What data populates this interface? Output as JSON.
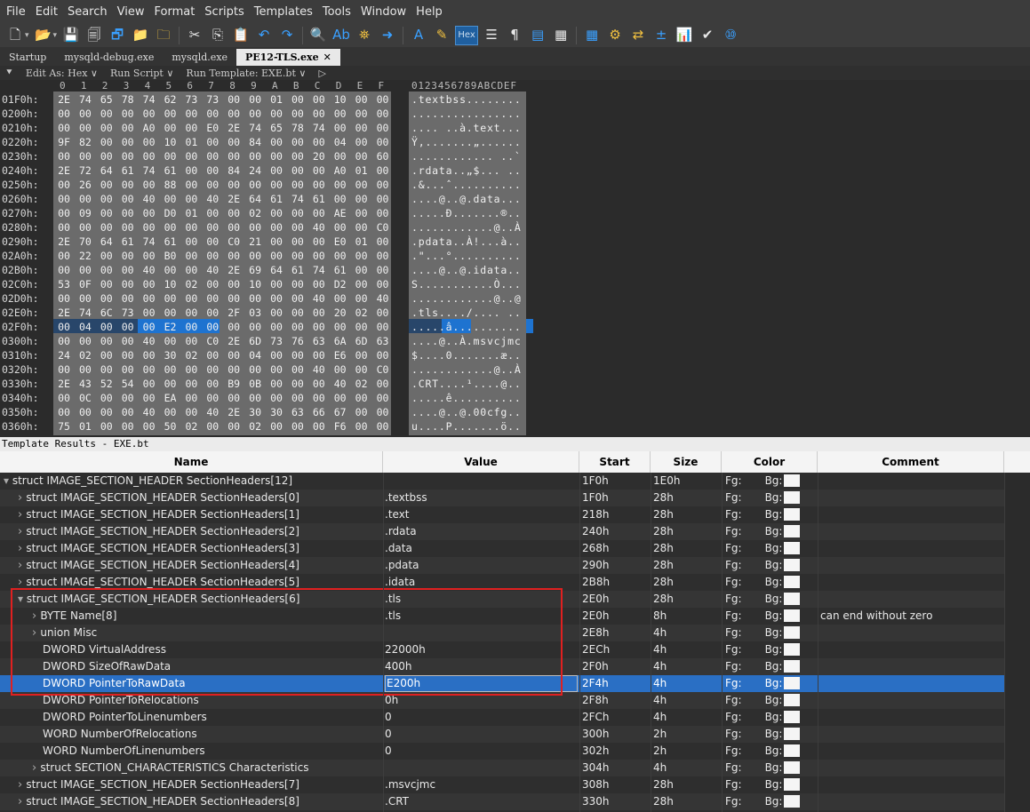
{
  "menu": [
    "File",
    "Edit",
    "Search",
    "View",
    "Format",
    "Scripts",
    "Templates",
    "Tools",
    "Window",
    "Help"
  ],
  "toolbar": {
    "icons": [
      "new-file-icon",
      "open-folder-icon",
      "save-icon",
      "save-as-icon",
      "save-all-icon",
      "open-folder-2-icon",
      "open-folders-icon",
      "cut-icon",
      "copy-icon",
      "paste-icon",
      "undo-icon",
      "redo-icon",
      "find-icon",
      "replace-icon",
      "find-in-files-icon",
      "goto-icon",
      "font-icon",
      "highlight-icon",
      "hex-mode-icon",
      "columns-icon",
      "pilcrow-icon",
      "text-mode-icon",
      "binary-mode-icon",
      "calculator-icon",
      "template-icon",
      "compare-icon",
      "operations-icon",
      "histogram-icon",
      "checksum-icon",
      "base-converter-icon"
    ],
    "hex_label": "Hex"
  },
  "tabs": [
    {
      "label": "Startup",
      "active": false
    },
    {
      "label": "mysqld-debug.exe",
      "active": false
    },
    {
      "label": "mysqld.exe",
      "active": false
    },
    {
      "label": "PE12-TLS.exe",
      "active": true,
      "close": "✕"
    }
  ],
  "subbar": {
    "edit_as": "Edit As: Hex ∨",
    "run_script": "Run Script ∨",
    "run_template": "Run Template: EXE.bt ∨",
    "play": "▷"
  },
  "hex": {
    "col_headers": [
      "0",
      "1",
      "2",
      "3",
      "4",
      "5",
      "6",
      "7",
      "8",
      "9",
      "A",
      "B",
      "C",
      "D",
      "E",
      "F"
    ],
    "ascii_header": "0123456789ABCDEF",
    "rows": [
      {
        "addr": "01F0h:",
        "bytes": [
          "2E",
          "74",
          "65",
          "78",
          "74",
          "62",
          "73",
          "73",
          "00",
          "00",
          "01",
          "00",
          "00",
          "10",
          "00",
          "00"
        ],
        "ascii": ".textbss........"
      },
      {
        "addr": "0200h:",
        "bytes": [
          "00",
          "00",
          "00",
          "00",
          "00",
          "00",
          "00",
          "00",
          "00",
          "00",
          "00",
          "00",
          "00",
          "00",
          "00",
          "00"
        ],
        "ascii": "................"
      },
      {
        "addr": "0210h:",
        "bytes": [
          "00",
          "00",
          "00",
          "00",
          "A0",
          "00",
          "00",
          "E0",
          "2E",
          "74",
          "65",
          "78",
          "74",
          "00",
          "00",
          "00"
        ],
        "ascii": ".... ..à.text..."
      },
      {
        "addr": "0220h:",
        "bytes": [
          "9F",
          "82",
          "00",
          "00",
          "00",
          "10",
          "01",
          "00",
          "00",
          "84",
          "00",
          "00",
          "00",
          "04",
          "00",
          "00"
        ],
        "ascii": "Ÿ‚.......„......"
      },
      {
        "addr": "0230h:",
        "bytes": [
          "00",
          "00",
          "00",
          "00",
          "00",
          "00",
          "00",
          "00",
          "00",
          "00",
          "00",
          "00",
          "20",
          "00",
          "00",
          "60"
        ],
        "ascii": "............ ..`"
      },
      {
        "addr": "0240h:",
        "bytes": [
          "2E",
          "72",
          "64",
          "61",
          "74",
          "61",
          "00",
          "00",
          "84",
          "24",
          "00",
          "00",
          "00",
          "A0",
          "01",
          "00"
        ],
        "ascii": ".rdata..„$... .."
      },
      {
        "addr": "0250h:",
        "bytes": [
          "00",
          "26",
          "00",
          "00",
          "00",
          "88",
          "00",
          "00",
          "00",
          "00",
          "00",
          "00",
          "00",
          "00",
          "00",
          "00"
        ],
        "ascii": ".&...ˆ.........."
      },
      {
        "addr": "0260h:",
        "bytes": [
          "00",
          "00",
          "00",
          "00",
          "40",
          "00",
          "00",
          "40",
          "2E",
          "64",
          "61",
          "74",
          "61",
          "00",
          "00",
          "00"
        ],
        "ascii": "....@..@.data..."
      },
      {
        "addr": "0270h:",
        "bytes": [
          "00",
          "09",
          "00",
          "00",
          "00",
          "D0",
          "01",
          "00",
          "00",
          "02",
          "00",
          "00",
          "00",
          "AE",
          "00",
          "00"
        ],
        "ascii": ".....Ð.......®.."
      },
      {
        "addr": "0280h:",
        "bytes": [
          "00",
          "00",
          "00",
          "00",
          "00",
          "00",
          "00",
          "00",
          "00",
          "00",
          "00",
          "00",
          "40",
          "00",
          "00",
          "C0"
        ],
        "ascii": "............@..À"
      },
      {
        "addr": "0290h:",
        "bytes": [
          "2E",
          "70",
          "64",
          "61",
          "74",
          "61",
          "00",
          "00",
          "C0",
          "21",
          "00",
          "00",
          "00",
          "E0",
          "01",
          "00"
        ],
        "ascii": ".pdata..À!...à.."
      },
      {
        "addr": "02A0h:",
        "bytes": [
          "00",
          "22",
          "00",
          "00",
          "00",
          "B0",
          "00",
          "00",
          "00",
          "00",
          "00",
          "00",
          "00",
          "00",
          "00",
          "00"
        ],
        "ascii": ".\"...°.........."
      },
      {
        "addr": "02B0h:",
        "bytes": [
          "00",
          "00",
          "00",
          "00",
          "40",
          "00",
          "00",
          "40",
          "2E",
          "69",
          "64",
          "61",
          "74",
          "61",
          "00",
          "00"
        ],
        "ascii": "....@..@.idata.."
      },
      {
        "addr": "02C0h:",
        "bytes": [
          "53",
          "0F",
          "00",
          "00",
          "00",
          "10",
          "02",
          "00",
          "00",
          "10",
          "00",
          "00",
          "00",
          "D2",
          "00",
          "00"
        ],
        "ascii": "S...........Ò..."
      },
      {
        "addr": "02D0h:",
        "bytes": [
          "00",
          "00",
          "00",
          "00",
          "00",
          "00",
          "00",
          "00",
          "00",
          "00",
          "00",
          "00",
          "40",
          "00",
          "00",
          "40"
        ],
        "ascii": "............@..@"
      },
      {
        "addr": "02E0h:",
        "bytes": [
          "2E",
          "74",
          "6C",
          "73",
          "00",
          "00",
          "00",
          "00",
          "2F",
          "03",
          "00",
          "00",
          "00",
          "20",
          "02",
          "00"
        ],
        "ascii": ".tls..../.... .."
      },
      {
        "addr": "02F0h:",
        "bytes": [
          "00",
          "04",
          "00",
          "00",
          "00",
          "E2",
          "00",
          "00",
          "00",
          "00",
          "00",
          "00",
          "00",
          "00",
          "00",
          "00"
        ],
        "ascii": ".....â.........."
      },
      {
        "addr": "0300h:",
        "bytes": [
          "00",
          "00",
          "00",
          "00",
          "40",
          "00",
          "00",
          "C0",
          "2E",
          "6D",
          "73",
          "76",
          "63",
          "6A",
          "6D",
          "63"
        ],
        "ascii": "....@..À.msvcjmc"
      },
      {
        "addr": "0310h:",
        "bytes": [
          "24",
          "02",
          "00",
          "00",
          "00",
          "30",
          "02",
          "00",
          "00",
          "04",
          "00",
          "00",
          "00",
          "E6",
          "00",
          "00"
        ],
        "ascii": "$....0.......æ.."
      },
      {
        "addr": "0320h:",
        "bytes": [
          "00",
          "00",
          "00",
          "00",
          "00",
          "00",
          "00",
          "00",
          "00",
          "00",
          "00",
          "00",
          "40",
          "00",
          "00",
          "C0"
        ],
        "ascii": "............@..À"
      },
      {
        "addr": "0330h:",
        "bytes": [
          "2E",
          "43",
          "52",
          "54",
          "00",
          "00",
          "00",
          "00",
          "B9",
          "0B",
          "00",
          "00",
          "00",
          "40",
          "02",
          "00"
        ],
        "ascii": ".CRT....¹....@.."
      },
      {
        "addr": "0340h:",
        "bytes": [
          "00",
          "0C",
          "00",
          "00",
          "00",
          "EA",
          "00",
          "00",
          "00",
          "00",
          "00",
          "00",
          "00",
          "00",
          "00",
          "00"
        ],
        "ascii": ".....ê.........."
      },
      {
        "addr": "0350h:",
        "bytes": [
          "00",
          "00",
          "00",
          "00",
          "40",
          "00",
          "00",
          "40",
          "2E",
          "30",
          "30",
          "63",
          "66",
          "67",
          "00",
          "00"
        ],
        "ascii": "....@..@.00cfg.."
      },
      {
        "addr": "0360h:",
        "bytes": [
          "75",
          "01",
          "00",
          "00",
          "00",
          "50",
          "02",
          "00",
          "00",
          "02",
          "00",
          "00",
          "00",
          "F6",
          "00",
          "00"
        ],
        "ascii": "u....P.......ö.."
      }
    ]
  },
  "template_results": {
    "title": "Template Results - EXE.bt",
    "columns": [
      "Name",
      "Value",
      "Start",
      "Size",
      "Color",
      "Comment"
    ],
    "fg_label": "Fg:",
    "bg_label": "Bg:",
    "rows": [
      {
        "indent": 0,
        "arrow": "down",
        "name": "struct IMAGE_SECTION_HEADER SectionHeaders[12]",
        "value": "",
        "start": "1F0h",
        "size": "1E0h",
        "comment": ""
      },
      {
        "indent": 1,
        "arrow": "right",
        "name": "struct IMAGE_SECTION_HEADER SectionHeaders[0]",
        "value": ".textbss",
        "start": "1F0h",
        "size": "28h",
        "comment": ""
      },
      {
        "indent": 1,
        "arrow": "right",
        "name": "struct IMAGE_SECTION_HEADER SectionHeaders[1]",
        "value": ".text",
        "start": "218h",
        "size": "28h",
        "comment": ""
      },
      {
        "indent": 1,
        "arrow": "right",
        "name": "struct IMAGE_SECTION_HEADER SectionHeaders[2]",
        "value": ".rdata",
        "start": "240h",
        "size": "28h",
        "comment": ""
      },
      {
        "indent": 1,
        "arrow": "right",
        "name": "struct IMAGE_SECTION_HEADER SectionHeaders[3]",
        "value": ".data",
        "start": "268h",
        "size": "28h",
        "comment": ""
      },
      {
        "indent": 1,
        "arrow": "right",
        "name": "struct IMAGE_SECTION_HEADER SectionHeaders[4]",
        "value": ".pdata",
        "start": "290h",
        "size": "28h",
        "comment": ""
      },
      {
        "indent": 1,
        "arrow": "right",
        "name": "struct IMAGE_SECTION_HEADER SectionHeaders[5]",
        "value": ".idata",
        "start": "2B8h",
        "size": "28h",
        "comment": ""
      },
      {
        "indent": 1,
        "arrow": "down",
        "name": "struct IMAGE_SECTION_HEADER SectionHeaders[6]",
        "value": ".tls",
        "start": "2E0h",
        "size": "28h",
        "comment": ""
      },
      {
        "indent": 2,
        "arrow": "right",
        "name": "BYTE Name[8]",
        "value": ".tls",
        "start": "2E0h",
        "size": "8h",
        "comment": "can end without zero"
      },
      {
        "indent": 2,
        "arrow": "right",
        "name": "union Misc",
        "value": "",
        "start": "2E8h",
        "size": "4h",
        "comment": ""
      },
      {
        "indent": 2,
        "arrow": "",
        "name": "DWORD VirtualAddress",
        "value": "22000h",
        "start": "2ECh",
        "size": "4h",
        "comment": ""
      },
      {
        "indent": 2,
        "arrow": "",
        "name": "DWORD SizeOfRawData",
        "value": "400h",
        "start": "2F0h",
        "size": "4h",
        "comment": ""
      },
      {
        "indent": 2,
        "arrow": "",
        "name": "DWORD PointerToRawData",
        "value": "E200h",
        "start": "2F4h",
        "size": "4h",
        "comment": "",
        "selected": true
      },
      {
        "indent": 2,
        "arrow": "",
        "name": "DWORD PointerToRelocations",
        "value": "0h",
        "start": "2F8h",
        "size": "4h",
        "comment": ""
      },
      {
        "indent": 2,
        "arrow": "",
        "name": "DWORD PointerToLinenumbers",
        "value": "0",
        "start": "2FCh",
        "size": "4h",
        "comment": ""
      },
      {
        "indent": 2,
        "arrow": "",
        "name": "WORD NumberOfRelocations",
        "value": "0",
        "start": "300h",
        "size": "2h",
        "comment": ""
      },
      {
        "indent": 2,
        "arrow": "",
        "name": "WORD NumberOfLinenumbers",
        "value": "0",
        "start": "302h",
        "size": "2h",
        "comment": ""
      },
      {
        "indent": 2,
        "arrow": "right",
        "name": "struct SECTION_CHARACTERISTICS Characteristics",
        "value": "",
        "start": "304h",
        "size": "4h",
        "comment": ""
      },
      {
        "indent": 1,
        "arrow": "right",
        "name": "struct IMAGE_SECTION_HEADER SectionHeaders[7]",
        "value": ".msvcjmc",
        "start": "308h",
        "size": "28h",
        "comment": ""
      },
      {
        "indent": 1,
        "arrow": "right",
        "name": "struct IMAGE_SECTION_HEADER SectionHeaders[8]",
        "value": ".CRT",
        "start": "330h",
        "size": "28h",
        "comment": ""
      }
    ]
  },
  "colors": {
    "selection_blue": "#2a6fc4",
    "highlight_red": "#e02020",
    "hex_bg": "#6b6b6b"
  }
}
